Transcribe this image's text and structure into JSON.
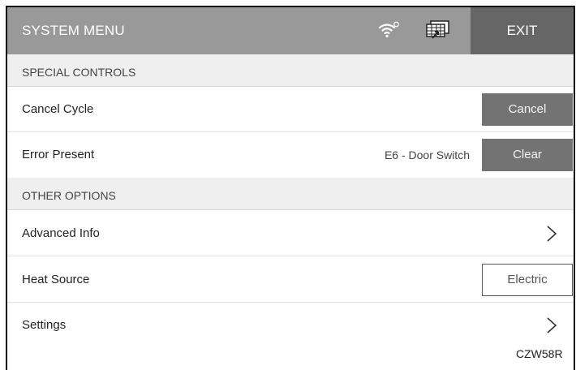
{
  "header": {
    "title": "SYSTEM MENU",
    "wifi_icon": "wifi-icon",
    "network_icon": "network-icon",
    "exit_label": "EXIT"
  },
  "sections": {
    "special_controls": "SPECIAL CONTROLS",
    "other_options": "OTHER OPTIONS"
  },
  "rows": {
    "cancel_cycle": {
      "label": "Cancel Cycle",
      "button": "Cancel"
    },
    "error_present": {
      "label": "Error Present",
      "status": "E6 - Door Switch",
      "button": "Clear"
    },
    "advanced_info": {
      "label": "Advanced Info",
      "icon": "chevron-right-icon"
    },
    "heat_source": {
      "label": "Heat Source",
      "button": "Electric"
    },
    "settings": {
      "label": "Settings",
      "icon": "chevron-right-icon"
    }
  },
  "footer": {
    "code": "CZW58R"
  },
  "colors": {
    "header_bg": "#999999",
    "exit_bg": "#666666",
    "button_bg": "#737373",
    "section_bg": "#efefef"
  }
}
